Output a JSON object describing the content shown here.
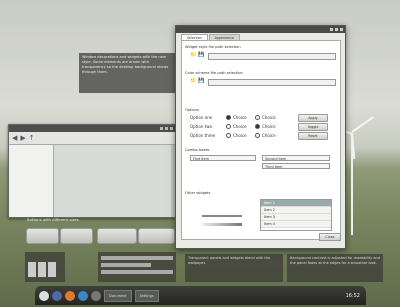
{
  "note": {
    "text": "Window decorations and widgets with the new style. Some elements are drawn with transparency so the desktop background shows through them."
  },
  "small_window": {
    "toolbar_icons": [
      "back-icon",
      "forward-icon",
      "up-icon"
    ]
  },
  "bottom_left": {
    "label": "Buttons with different sizes",
    "panel_text": "Transparent panels and widgets blend with the wallpaper."
  },
  "bottom_right": {
    "panel_text": "Background contrast is adjusted for readability and the panel fades at the edges for a smoother look."
  },
  "dialog": {
    "tabs": [
      "Selection",
      "Appearance"
    ],
    "group1_label": "Widget style file path selection",
    "group2_label": "Color scheme file path selection",
    "options_label": "Options",
    "radio_rows": [
      {
        "label": "Option one",
        "a": "Choice",
        "b": "Choice",
        "btn": "Apply"
      },
      {
        "label": "Option two",
        "a": "Choice",
        "b": "Choice",
        "btn": "Toggle"
      },
      {
        "label": "Option three",
        "a": "Choice",
        "b": "Choice",
        "btn": "Reset"
      }
    ],
    "combo_label": "Combo boxes",
    "combos": [
      "First item",
      "Second item",
      "Third item"
    ],
    "slider_label": "Other widgets",
    "list_items": [
      "Item 1",
      "Item 2",
      "Item 3",
      "Item 4"
    ],
    "ok": "Close"
  },
  "taskbar": {
    "tasks": [
      "Document",
      "Settings"
    ],
    "clock": "16:52"
  },
  "colors": {
    "accent": "#4a4b48",
    "selection": "#99aaaa"
  }
}
